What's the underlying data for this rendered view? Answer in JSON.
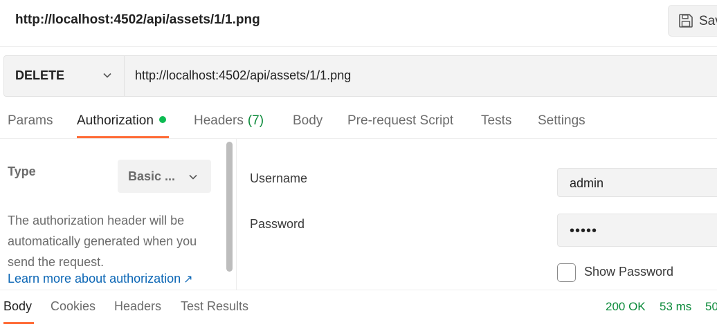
{
  "header": {
    "title": "http://localhost:4502/api/assets/1/1.png",
    "save_label": "Sav"
  },
  "request": {
    "method": "DELETE",
    "url": "http://localhost:4502/api/assets/1/1.png"
  },
  "tabs": [
    {
      "label": "Params"
    },
    {
      "label": "Authorization",
      "active": true
    },
    {
      "label": "Headers",
      "count": "(7)"
    },
    {
      "label": "Body"
    },
    {
      "label": "Pre-request Script"
    },
    {
      "label": "Tests"
    },
    {
      "label": "Settings"
    }
  ],
  "auth": {
    "type_label": "Type",
    "type_value": "Basic ...",
    "description": "The authorization header will be automatically generated when you send the request.",
    "learn_more": "Learn more about authorization",
    "learn_more_arrow": "↗",
    "username_label": "Username",
    "username_value": "admin",
    "password_label": "Password",
    "password_value": "•••••",
    "show_password_label": "Show Password"
  },
  "response": {
    "tabs": [
      {
        "label": "Body",
        "active": true
      },
      {
        "label": "Cookies"
      },
      {
        "label": "Headers"
      },
      {
        "label": "Test Results"
      }
    ],
    "status": "200 OK",
    "time": "53 ms",
    "size": "50"
  },
  "colors": {
    "accent": "#ff6c37",
    "status_ok": "#0b8a3a",
    "link": "#0b66b5",
    "auth_dot": "#0cbb52"
  },
  "icons": [
    "save-icon",
    "chevron-down-icon",
    "external-link-arrow-icon"
  ]
}
